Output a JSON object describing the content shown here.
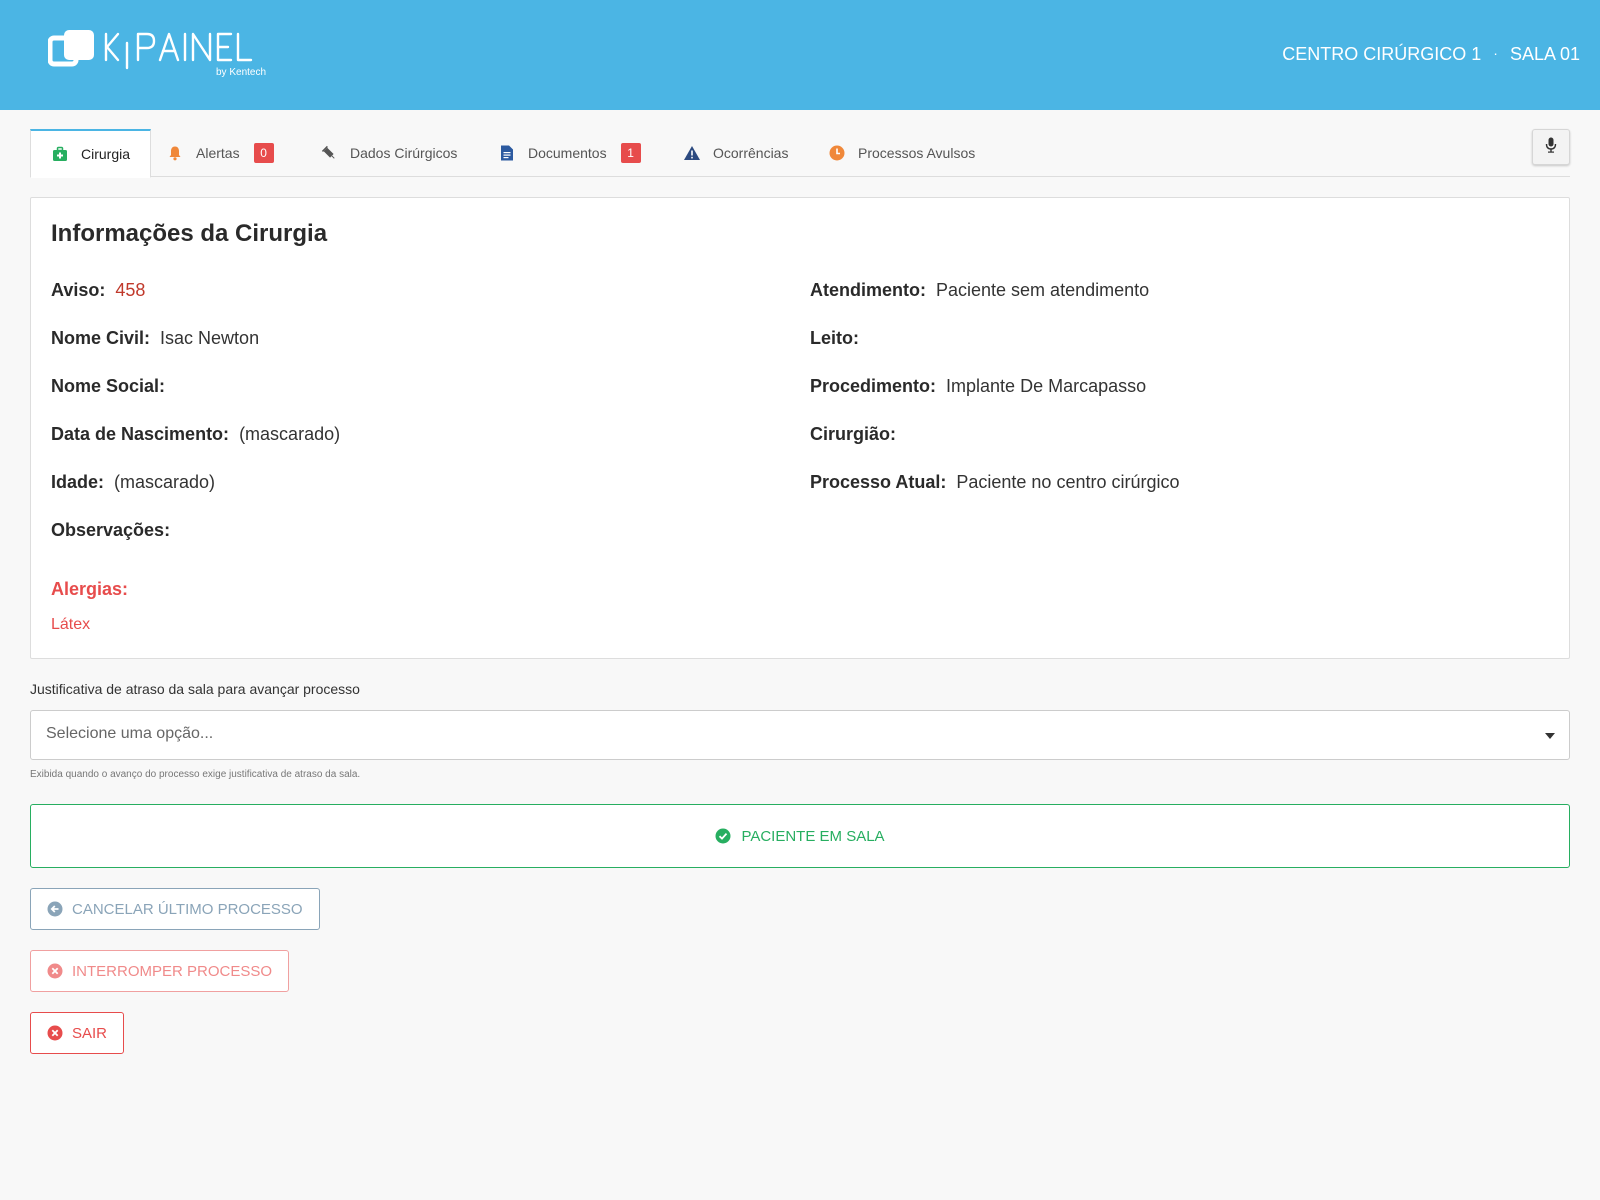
{
  "header": {
    "logo_text": "K|PAINEL",
    "logo_by": "by Kentech",
    "location": "CENTRO CIRÚRGICO 1",
    "separator": "·",
    "room": "SALA 01"
  },
  "tabs": [
    {
      "label": "Cirurgia",
      "icon": "medical-kit-icon",
      "active": true
    },
    {
      "label": "Alertas",
      "icon": "bell-icon",
      "badge": "0"
    },
    {
      "label": "Dados Cirúrgicos",
      "icon": "syringe-icon"
    },
    {
      "label": "Documentos",
      "icon": "document-icon",
      "badge": "1"
    },
    {
      "label": "Ocorrências",
      "icon": "warning-icon"
    },
    {
      "label": "Processos Avulsos",
      "icon": "clock-icon"
    }
  ],
  "card": {
    "title": "Informações da Cirurgia",
    "left": [
      {
        "label": "Aviso:",
        "value": "458"
      },
      {
        "label": "Nome Civil:",
        "value": "Isac Newton"
      },
      {
        "label": "Nome Social:",
        "value": ""
      },
      {
        "label": "Data de Nascimento:",
        "value": "(mascarado)"
      },
      {
        "label": "Idade:",
        "value": "(mascarado)"
      },
      {
        "label": "Observações:",
        "value": ""
      }
    ],
    "right": [
      {
        "label": "Atendimento:",
        "value": "Paciente sem atendimento"
      },
      {
        "label": "Leito:",
        "value": ""
      },
      {
        "label": "Procedimento:",
        "value": "Implante De Marcapasso"
      },
      {
        "label": "Cirurgião:",
        "value": ""
      },
      {
        "label": "Processo Atual:",
        "value": "Paciente no centro cirúrgico"
      }
    ],
    "allergies_title": "Alergias:",
    "allergies": [
      "Látex"
    ]
  },
  "delay": {
    "label": "Justificativa de atraso da sala para avançar processo",
    "placeholder": "Selecione uma opção...",
    "hint": "Exibida quando o avanço do processo exige justificativa de atraso da sala."
  },
  "actions": {
    "primary": "PACIENTE EM SALA",
    "cancel": "CANCELAR ÚLTIMO PROCESSO",
    "interrupt": "INTERROMPER PROCESSO",
    "exit": "SAIR"
  },
  "colors": {
    "header": "#4bb5e4",
    "success": "#27ae60",
    "danger": "#e74c4c",
    "muted": "#8aa4b8"
  }
}
